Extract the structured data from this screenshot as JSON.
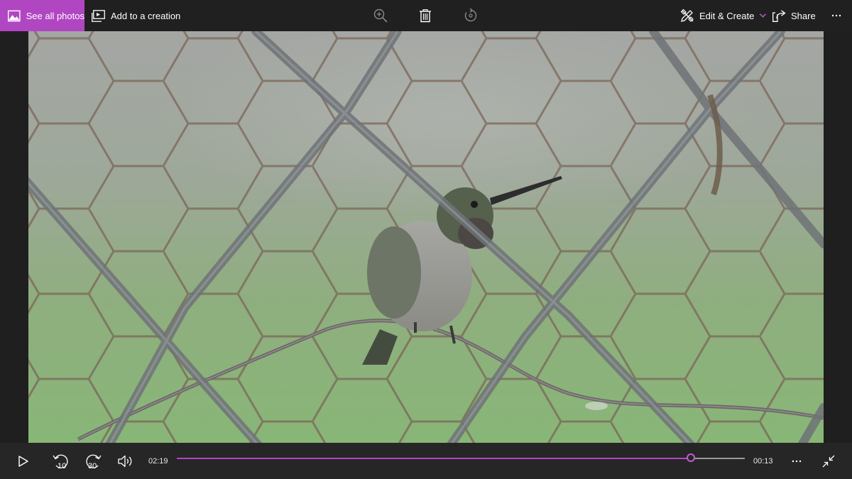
{
  "toolbar": {
    "see_all_photos": "See all photos",
    "add_to_creation": "Add to a creation",
    "edit_create": "Edit & Create",
    "share": "Share",
    "more": "…"
  },
  "player": {
    "elapsed": "02:19",
    "remaining": "00:13",
    "skip_back_seconds": "10",
    "skip_forward_seconds": "30",
    "progress": 0.905,
    "more": "…"
  },
  "colors": {
    "accent": "#b146c2",
    "toolbar_bg": "#202020"
  },
  "icons": [
    "photos-icon",
    "add-to-creation-icon",
    "zoom-icon",
    "delete-icon",
    "rotate-icon",
    "edit-create-icon",
    "chevron-down-icon",
    "share-icon",
    "more-icon",
    "play-icon",
    "skip-back-icon",
    "skip-forward-icon",
    "volume-icon",
    "exit-fullscreen-icon"
  ]
}
